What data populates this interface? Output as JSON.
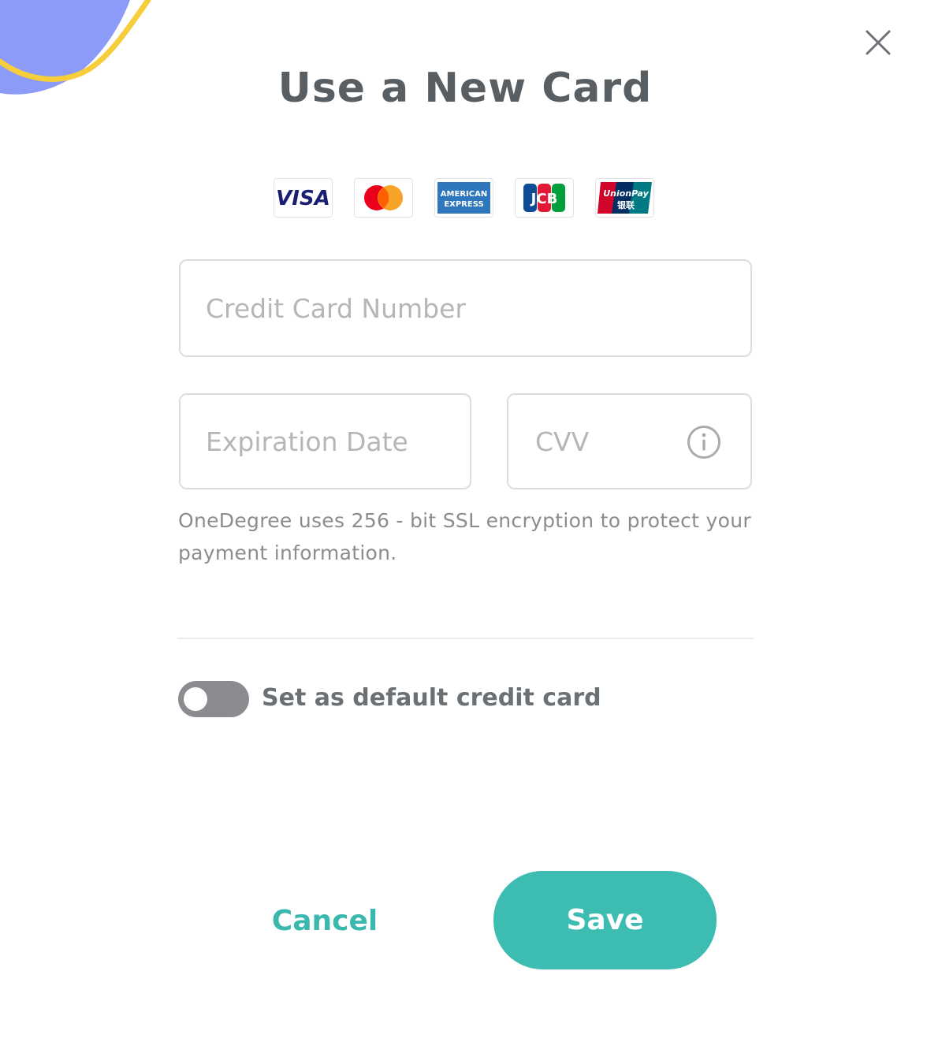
{
  "dialog": {
    "title": "Use a New Card",
    "close_icon": "close-icon"
  },
  "brands": [
    {
      "name": "Visa",
      "label": "VISA",
      "icon": "visa-logo-icon"
    },
    {
      "name": "Mastercard",
      "icon": "mastercard-logo-icon"
    },
    {
      "name": "American Express",
      "label_top": "AMERICAN",
      "label_bottom": "EXPRESS",
      "icon": "amex-logo-icon"
    },
    {
      "name": "JCB",
      "label": "JCB",
      "icon": "jcb-logo-icon"
    },
    {
      "name": "UnionPay",
      "label_top": "UnionPay",
      "label_bottom": "银联",
      "icon": "unionpay-logo-icon"
    }
  ],
  "form": {
    "card_number": {
      "value": "",
      "placeholder": "Credit Card Number"
    },
    "expiration": {
      "value": "",
      "placeholder": "Expiration Date"
    },
    "cvv": {
      "value": "",
      "placeholder": "CVV",
      "icon": "info-icon"
    },
    "security_note": "OneDegree uses 256 - bit SSL encryption to protect your payment information."
  },
  "default_toggle": {
    "label": "Set as default credit card",
    "checked": false
  },
  "actions": {
    "cancel_label": "Cancel",
    "save_label": "Save"
  },
  "colors": {
    "accent": "#3dbdb1",
    "toggle_off": "#8a8c8f",
    "decor_blue": "#8b9bf7",
    "decor_yellow": "#f6cd3a"
  }
}
